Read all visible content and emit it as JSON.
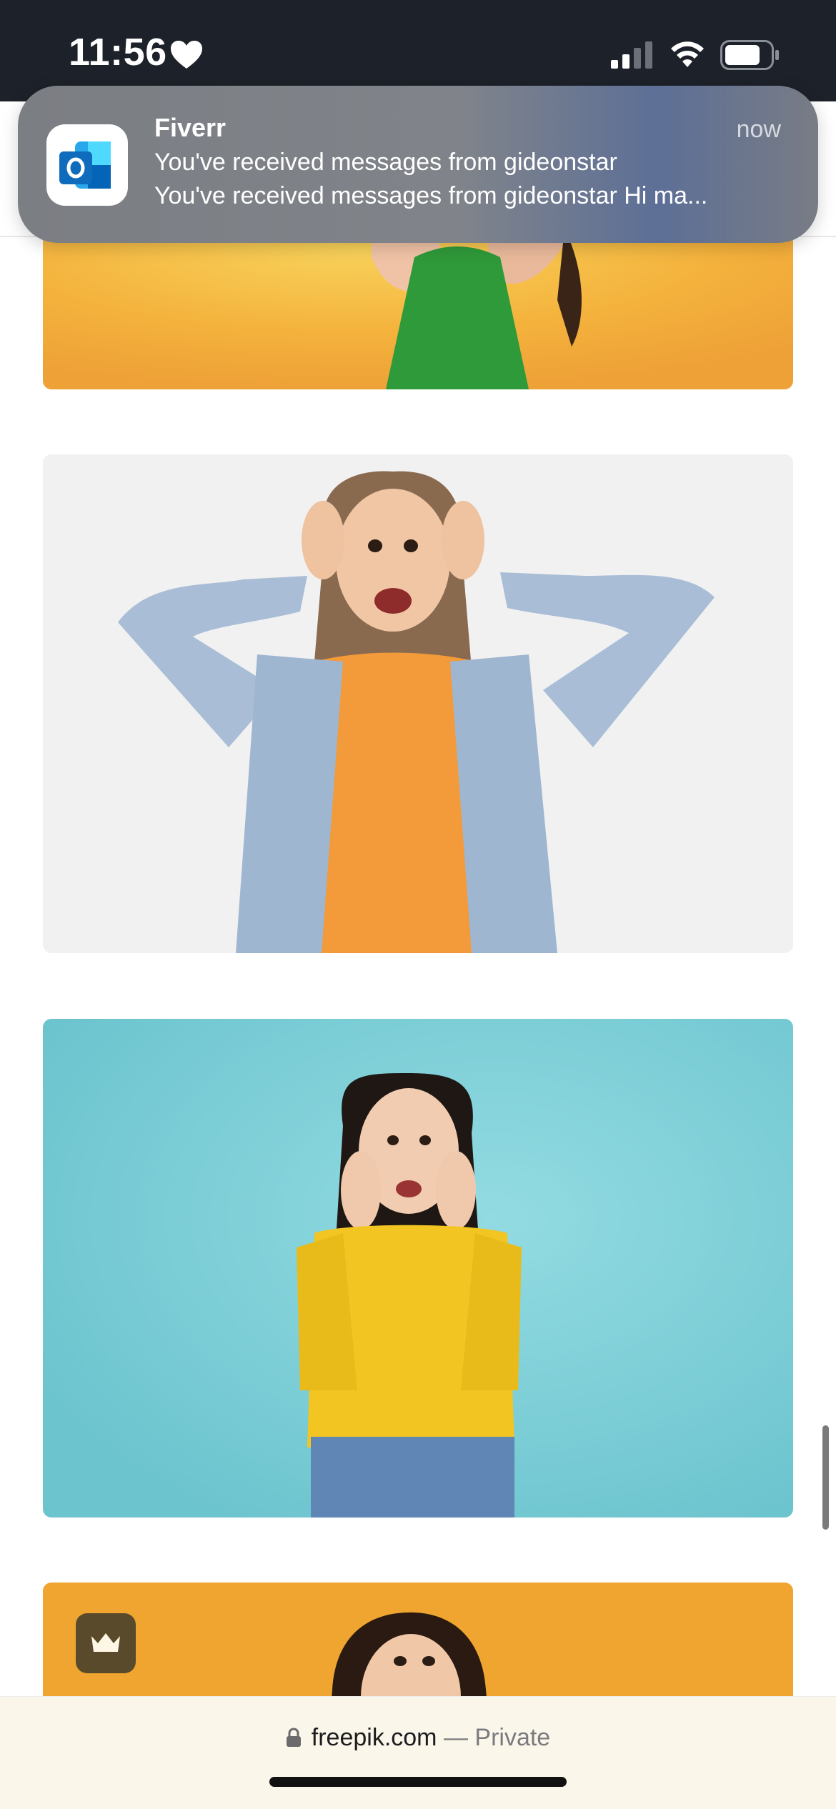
{
  "status_bar": {
    "time": "11:56",
    "icons": [
      "heart-icon",
      "cellular-signal-icon",
      "wifi-icon",
      "battery-icon"
    ],
    "signal_bars_active": 2,
    "signal_bars_total": 4,
    "battery_level": 0.7
  },
  "notification": {
    "app_icon": "outlook-icon",
    "title": "Fiverr",
    "time": "now",
    "line1": "You've received messages from gideonstar",
    "line2": "You've received messages from gideonstar Hi ma..."
  },
  "content": {
    "images": [
      {
        "name": "woman-green-dress-orange-background",
        "background": "#f2a93a"
      },
      {
        "name": "woman-denim-jacket-hands-on-head",
        "background": "#f1f1f1"
      },
      {
        "name": "woman-yellow-sweater-teal-background",
        "background": "#7fcdd6"
      },
      {
        "name": "woman-orange-background",
        "background": "#f0a530"
      }
    ],
    "premium_badge_icon": "crown-icon"
  },
  "browser": {
    "url_domain": "freepik.com",
    "url_suffix": " — Private",
    "lock_icon": "lock-icon"
  },
  "colors": {
    "status_bar_bg": "#1d2129",
    "url_bar_bg": "#fbf6ea",
    "outlook_blue": "#0f6cbd"
  }
}
